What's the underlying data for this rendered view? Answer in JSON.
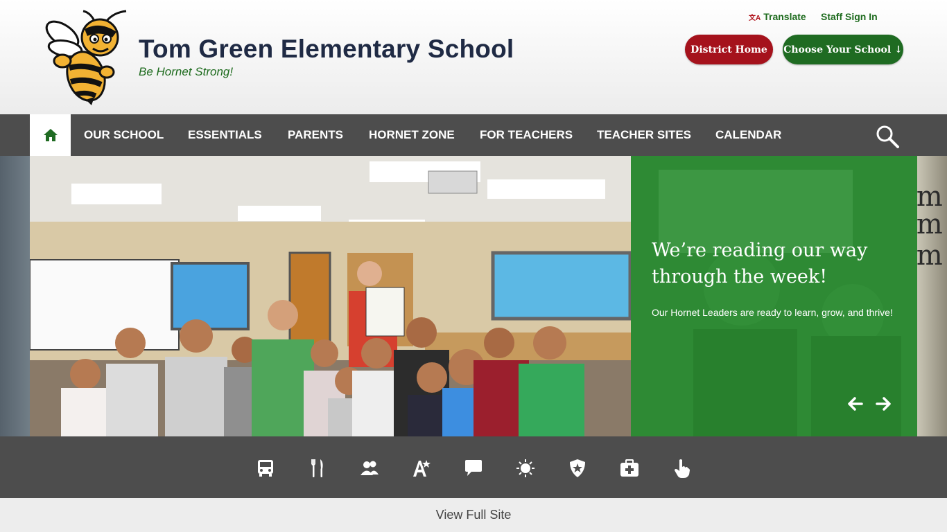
{
  "header": {
    "school_name": "Tom Green Elementary School",
    "tagline": "Be Hornet Strong!",
    "translate_label": "Translate",
    "staff_sign_in_label": "Staff Sign In",
    "district_home_label": "District Home",
    "choose_school_label": "Choose Your School ↓"
  },
  "nav": {
    "home_icon": "home-icon",
    "items": [
      "OUR SCHOOL",
      "ESSENTIALS",
      "PARENTS",
      "HORNET ZONE",
      "FOR TEACHERS",
      "TEACHER SITES",
      "CALENDAR"
    ],
    "search_icon": "search-icon"
  },
  "hero": {
    "title": "We’re reading our way through the week!",
    "text": "Our Hornet Leaders are ready to learn, grow, and thrive!",
    "bg_right_text": [
      "I am",
      "I am",
      "I am"
    ],
    "prev_icon": "arrow-left-icon",
    "next_icon": "arrow-right-icon"
  },
  "quick_links": [
    "bus-icon",
    "utensils-icon",
    "users-icon",
    "translate-icon",
    "chat-icon",
    "sun-icon",
    "police-badge-icon",
    "first-aid-icon",
    "pointer-hand-icon"
  ],
  "footer": {
    "view_full_site": "View Full Site"
  },
  "colors": {
    "brand_green": "#1f6b22",
    "brand_red": "#a5121c",
    "nav_gray": "#4d4d4d",
    "caption_green": "#2e8a34",
    "title_navy": "#1f2a44"
  }
}
